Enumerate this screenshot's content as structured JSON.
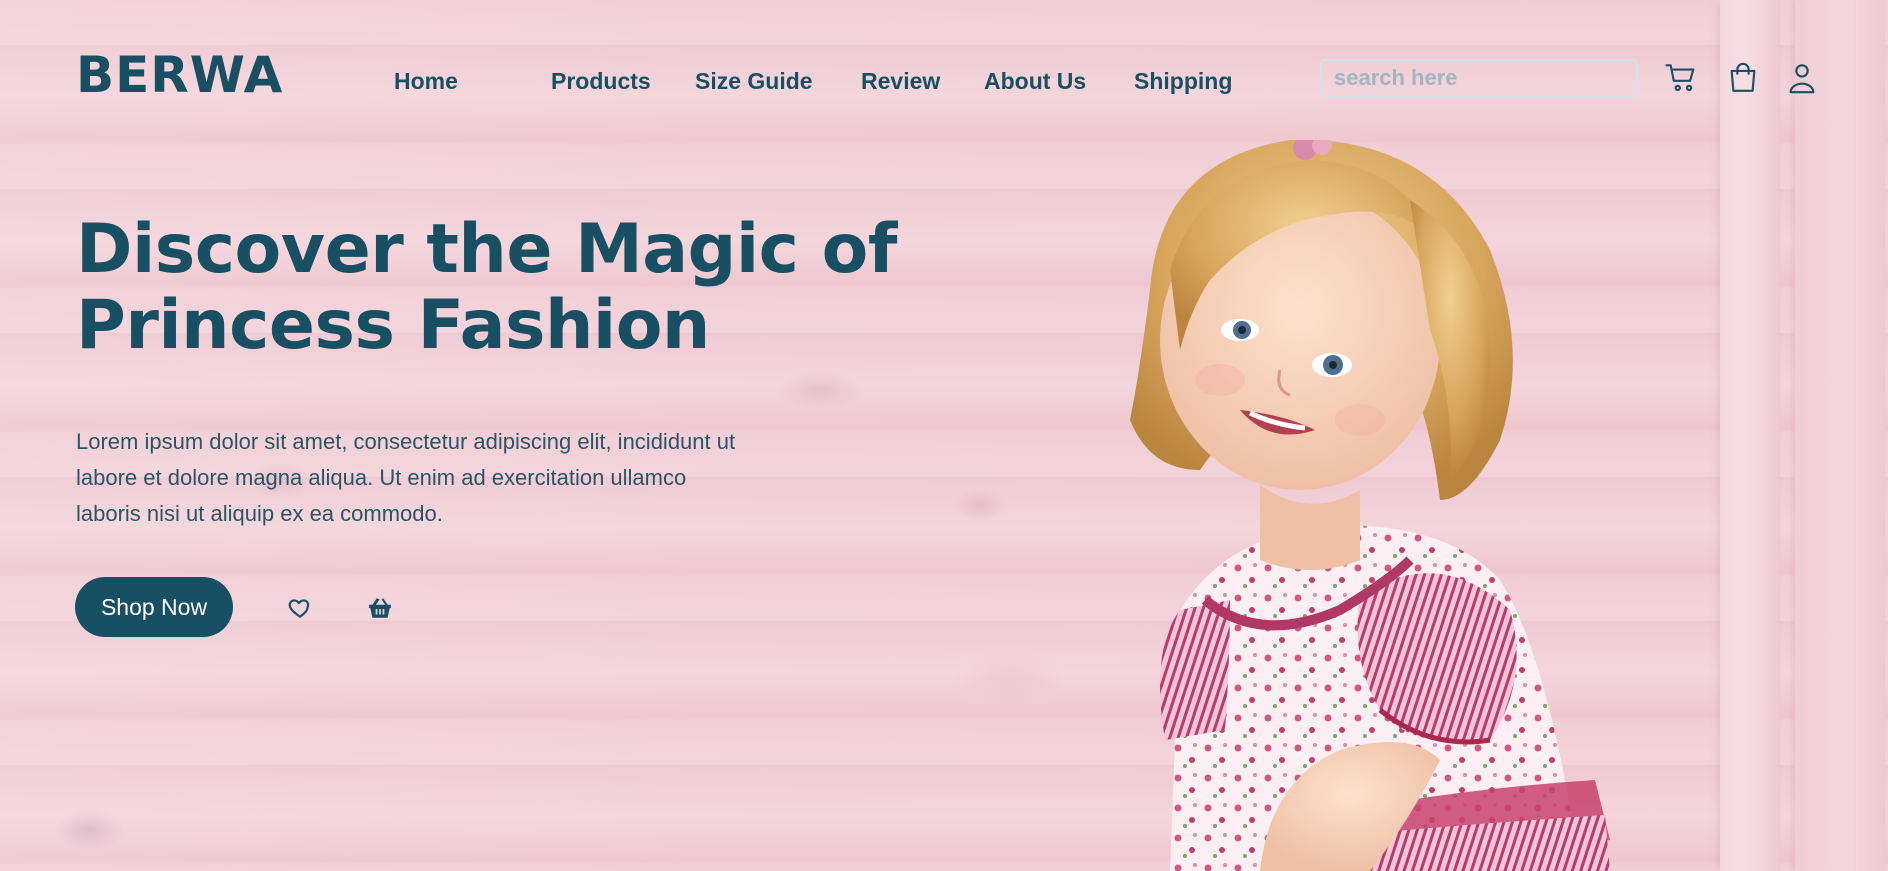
{
  "brand": {
    "name": "BERWA"
  },
  "nav": {
    "items": [
      {
        "label": "Home"
      },
      {
        "label": "Products"
      },
      {
        "label": "Size Guide"
      },
      {
        "label": "Review"
      },
      {
        "label": "About Us"
      },
      {
        "label": "Shipping"
      }
    ]
  },
  "search": {
    "value": "",
    "placeholder": "search here"
  },
  "header_icons": [
    "cart-icon",
    "bag-icon",
    "user-icon"
  ],
  "hero": {
    "title": "Discover the Magic of Princess Fashion",
    "description": "Lorem ipsum dolor sit amet, consectetur adipiscing elit, incididunt ut labore et dolore magna aliqua. Ut enim ad exercitation ullamco laboris nisi ut aliquip ex ea commodo.",
    "cta_label": "Shop Now",
    "action_icons": [
      "heart-icon",
      "basket-icon"
    ]
  },
  "colors": {
    "primary": "#184f63",
    "background": "#f1cdd5",
    "search_border": "#cfe3ec",
    "button_text": "#ffffff"
  }
}
